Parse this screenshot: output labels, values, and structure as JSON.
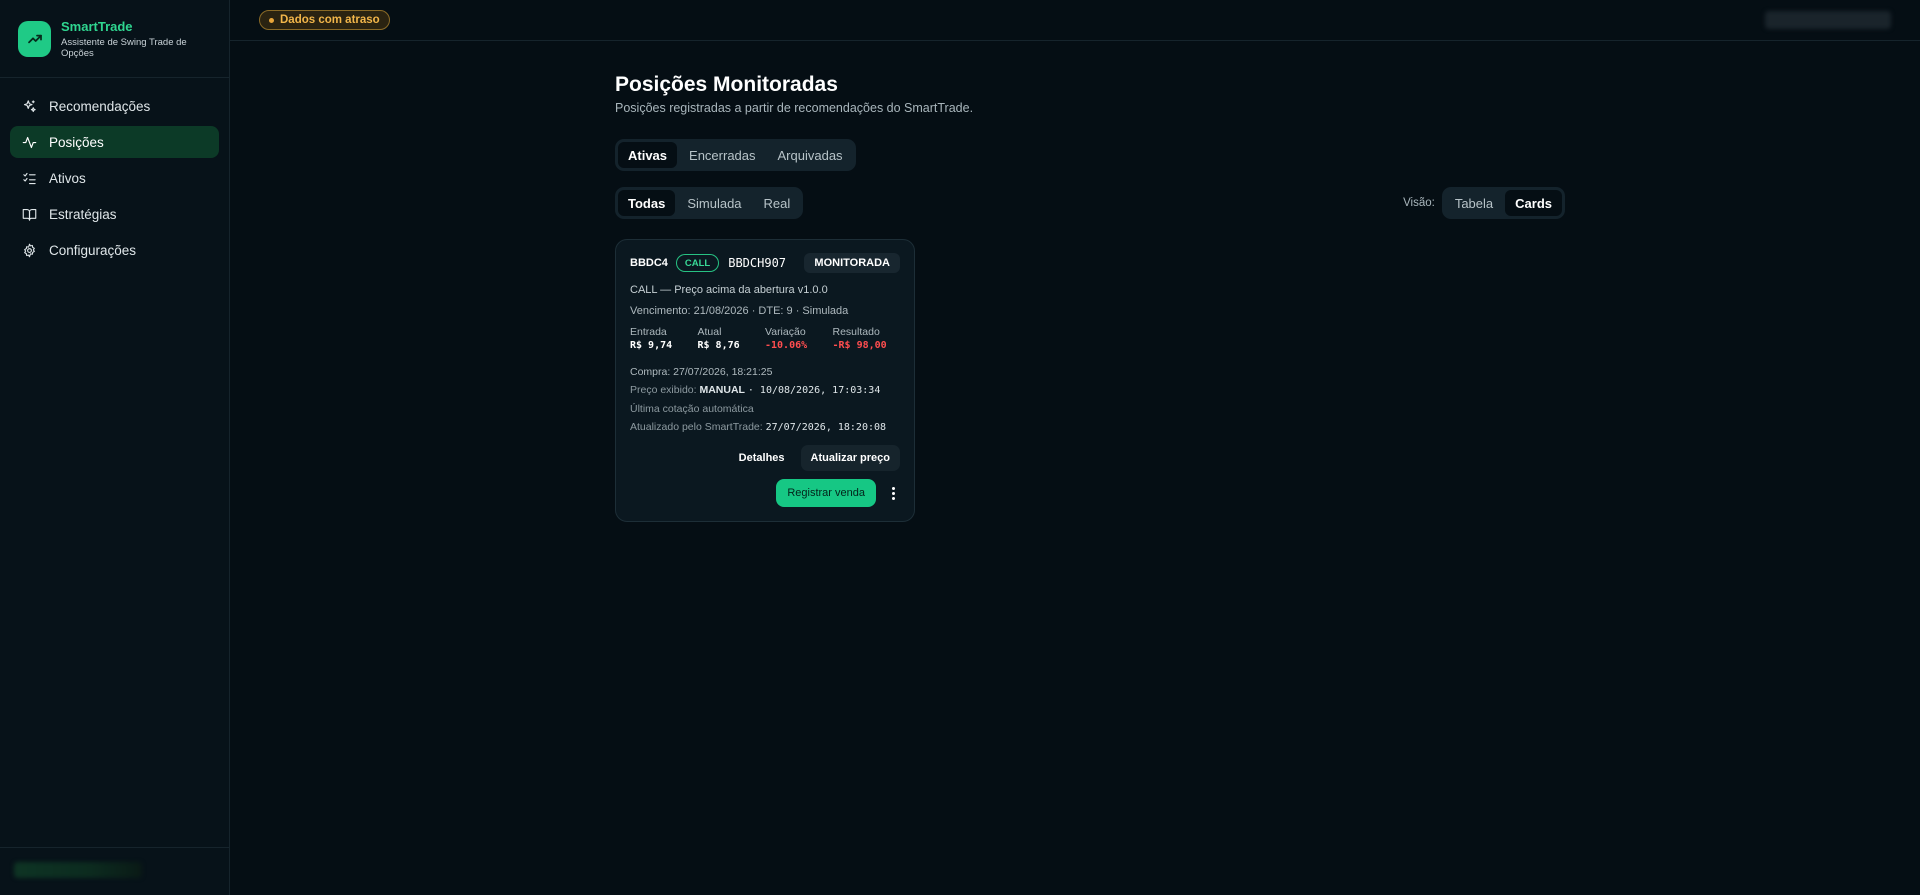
{
  "brand": {
    "name": "SmartTrade",
    "subtitle": "Assistente de Swing Trade de Opções"
  },
  "nav": {
    "items": [
      {
        "label": "Recomendações",
        "icon": "sparkles-icon"
      },
      {
        "label": "Posições",
        "icon": "activity-icon",
        "active": true
      },
      {
        "label": "Ativos",
        "icon": "list-checks-icon"
      },
      {
        "label": "Estratégias",
        "icon": "book-open-icon"
      },
      {
        "label": "Configurações",
        "icon": "gear-icon"
      }
    ]
  },
  "topbar": {
    "delay_badge": "Dados com atraso"
  },
  "page": {
    "title": "Posições Monitoradas",
    "subtitle": "Posições registradas a partir de recomendações do SmartTrade."
  },
  "status_tabs": [
    {
      "label": "Ativas",
      "active": true
    },
    {
      "label": "Encerradas",
      "active": false
    },
    {
      "label": "Arquivadas",
      "active": false
    }
  ],
  "type_filters": [
    {
      "label": "Todas",
      "active": true
    },
    {
      "label": "Simulada",
      "active": false
    },
    {
      "label": "Real",
      "active": false
    }
  ],
  "view": {
    "label": "Visão:",
    "options": [
      {
        "label": "Tabela",
        "active": false
      },
      {
        "label": "Cards",
        "active": true
      }
    ]
  },
  "position_card": {
    "ticker": "BBDC4",
    "type_badge": "CALL",
    "option_code": "BBDCH907",
    "status": "MONITORADA",
    "strategy": "CALL — Preço acima da abertura v1.0.0",
    "expiry": "Vencimento: 21/08/2026 · DTE: 9 · Simulada",
    "metrics": [
      {
        "label": "Entrada",
        "value": "R$ 9,74"
      },
      {
        "label": "Atual",
        "value": "R$ 8,76"
      },
      {
        "label": "Variação",
        "value": "-10.06%"
      },
      {
        "label": "Resultado",
        "value": "-R$ 98,00"
      }
    ],
    "purchase": "Compra: 27/07/2026, 18:21:25",
    "price_shown_label": "Preço exibido:",
    "price_shown_source": "MANUAL",
    "price_shown_time": "· 10/08/2026, 17:03:34",
    "last_quote": "Última cotação automática",
    "updated_label": "Atualizado pelo SmartTrade:",
    "updated_time": "27/07/2026, 18:20:08",
    "details_label": "Detalhes",
    "update_price_label": "Atualizar preço",
    "register_sale_label": "Registrar venda"
  },
  "colors": {
    "accent": "#16c784",
    "negative": "#ff4d4f",
    "warning": "#f2b64a",
    "background": "#050e14"
  }
}
